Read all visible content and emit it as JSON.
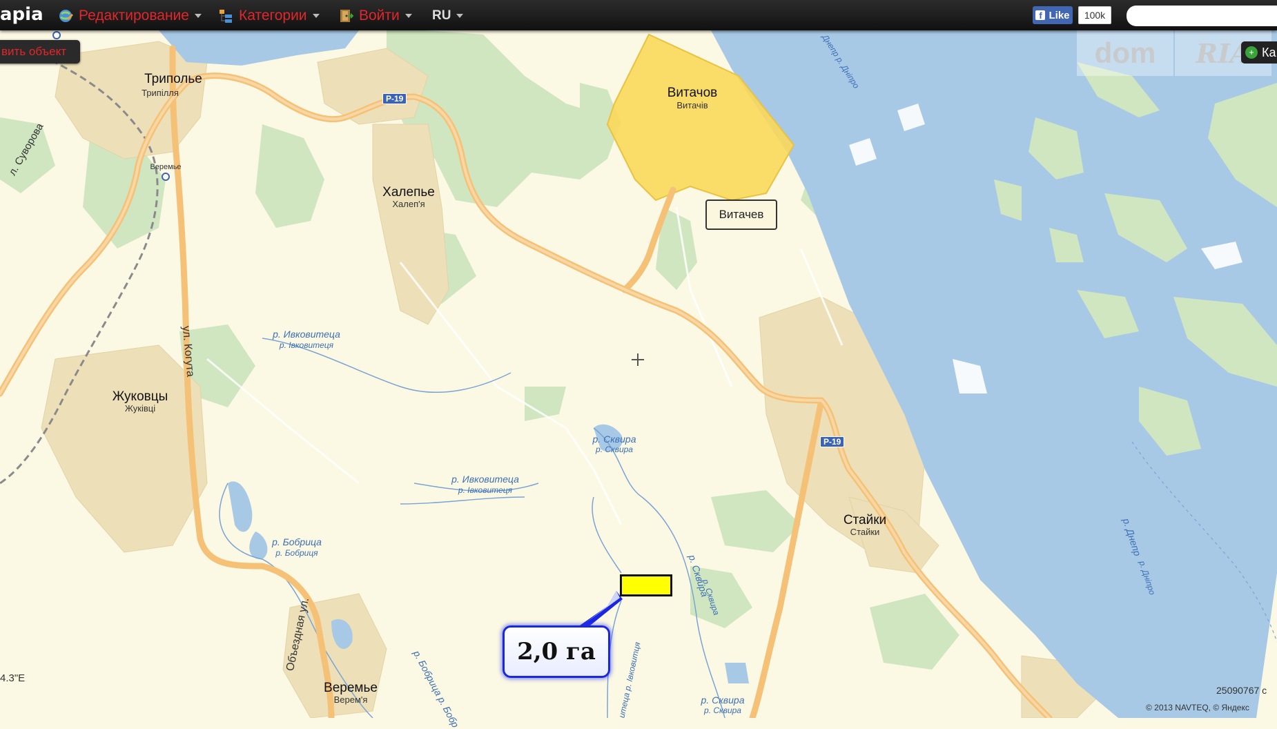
{
  "toolbar": {
    "logo": "apia",
    "menu_edit": "Редактирование",
    "menu_categories": "Категории",
    "menu_login": "Войти",
    "menu_lang": "RU",
    "fb_like": "Like",
    "fb_count": "100k",
    "search_placeholder": ""
  },
  "sidebar": {
    "add_object": "вить объект",
    "categories_button": "Ка"
  },
  "watermarks": {
    "left": "dom",
    "right": "RIA"
  },
  "map": {
    "places": [
      {
        "name": "Триполье",
        "sub": "Трипілля"
      },
      {
        "name": "Халепье",
        "sub": "Халеп'я"
      },
      {
        "name": "Витачов",
        "sub": "Витачів"
      },
      {
        "name": "Жуковцы",
        "sub": "Жуківці"
      },
      {
        "name": "Стайки",
        "sub": "Стайки"
      },
      {
        "name": "Веремье",
        "sub": "Верем'я"
      }
    ],
    "station": "Веремье",
    "streets": [
      "л. Суворова",
      "ул. Когута",
      "Объездная ул."
    ],
    "roads": [
      "Р-19",
      "Р-19"
    ],
    "rivers": [
      {
        "name": "р. Ивковитеца",
        "sub": "р. Івковитеця"
      },
      {
        "name": "р. Ивковитеца",
        "sub": "р. Івковитеця"
      },
      {
        "name": "р. Сквира",
        "sub": "р. Сквира"
      },
      {
        "name": "р. Бобрица",
        "sub": "р. Бобриця"
      },
      {
        "name": "р. Сквира",
        "sub": "р. Сквира"
      },
      {
        "name": "р. Сквира",
        "sub": "р. Сквира"
      }
    ],
    "dnepr_label": "р. Днепр",
    "dnepr_sub": "р. Дніпро",
    "dnepr_top": "Днепр р. Дніпро",
    "bobrica_vertical": "р. Бобрица р. Бобр",
    "ivkov_vertical": "итеца р. Івковитця",
    "tooltip": "Витачев",
    "coordinate": "4.3\"E",
    "scale_text": "25090767 с",
    "copyright": "© 2013 NAVTEQ, © Яндекс"
  },
  "annotation": {
    "area": "2,0 га"
  },
  "colors": {
    "land": "#fbf8e3",
    "water": "#a8c9e6",
    "forest": "#cfe6c0",
    "town": "#ede0b8",
    "road": "#f5c177",
    "highlight": "#f9d85a",
    "plot": "#ffff00",
    "callout_border": "#1b26e0"
  }
}
